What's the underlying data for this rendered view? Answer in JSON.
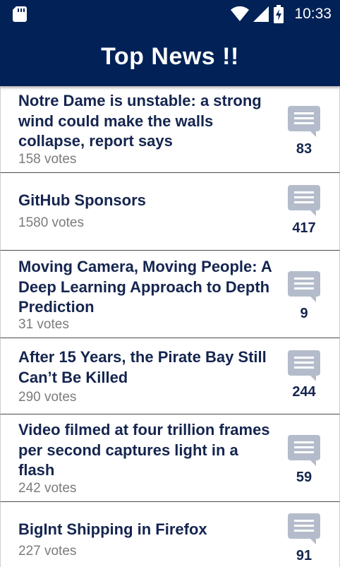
{
  "status_bar": {
    "time": "10:33",
    "icons": [
      "sd-card-icon",
      "wifi-icon",
      "signal-icon",
      "battery-charging-icon"
    ]
  },
  "app_bar": {
    "title": "Top News !!"
  },
  "colors": {
    "primary": "#022257",
    "title_text": "#15254f",
    "votes_text": "#7b7b7b",
    "icon": "#b4bccb"
  },
  "news": [
    {
      "title": "Notre Dame is unstable: a strong wind could make the walls collapse, report says",
      "votes": "158 votes",
      "comments": "83"
    },
    {
      "title": "GitHub Sponsors",
      "votes": "1580 votes",
      "comments": "417"
    },
    {
      "title": "Moving Camera, Moving People: A Deep Learning Approach to Depth Prediction",
      "votes": "31 votes",
      "comments": "9"
    },
    {
      "title": "After 15 Years, the Pirate Bay Still Can’t Be Killed",
      "votes": "290 votes",
      "comments": "244"
    },
    {
      "title": "Video filmed at four trillion frames per second captures light in a flash",
      "votes": "242 votes",
      "comments": "59"
    },
    {
      "title": "BigInt Shipping in Firefox",
      "votes": "227 votes",
      "comments": "91"
    }
  ]
}
